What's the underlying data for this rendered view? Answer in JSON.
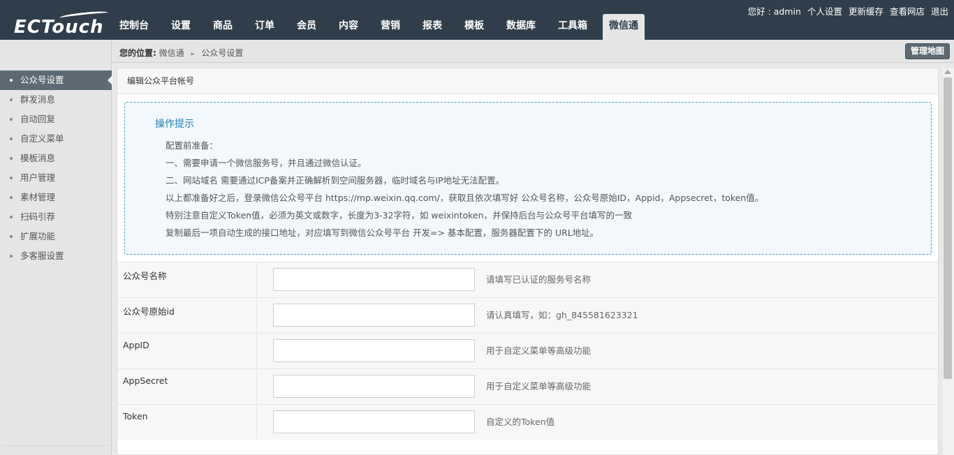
{
  "header": {
    "logo": "ECTouch",
    "nav": [
      "控制台",
      "设置",
      "商品",
      "订单",
      "会员",
      "内容",
      "营销",
      "报表",
      "模板",
      "数据库",
      "工具箱",
      "微信通"
    ],
    "active_nav_index": 11,
    "user_links": [
      "您好 : admin",
      "个人设置",
      "更新缓存",
      "查看网店",
      "退出"
    ]
  },
  "breadcrumb": {
    "prefix": "您的位置:",
    "level1": "微信通",
    "level2": "公众号设置",
    "sitemap_button": "管理地图"
  },
  "sidebar": {
    "items": [
      {
        "label": "公众号设置",
        "active": true
      },
      {
        "label": "群发消息",
        "active": false
      },
      {
        "label": "自动回复",
        "active": false
      },
      {
        "label": "自定义菜单",
        "active": false
      },
      {
        "label": "模板消息",
        "active": false
      },
      {
        "label": "用户管理",
        "active": false
      },
      {
        "label": "素材管理",
        "active": false
      },
      {
        "label": "扫码引荐",
        "active": false
      },
      {
        "label": "扩展功能",
        "active": false
      },
      {
        "label": "多客服设置",
        "active": false
      }
    ]
  },
  "panel": {
    "title": "编辑公众平台帐号",
    "tips_title": "操作提示",
    "tips": [
      "配置前准备：",
      "一、需要申请一个微信服务号，并且通过微信认证。",
      "二、网站域名 需要通过ICP备案并正确解析到空间服务器，临时域名与IP地址无法配置。",
      "以上都准备好之后，登录微信公众号平台 https://mp.weixin.qq.com/，获取且依次填写好 公众号名称，公众号原始ID，Appid，Appsecret，token值。",
      "特别注意自定义Token值，必须为英文或数字，长度为3-32字符，如 weixintoken，并保持后台与公众号平台填写的一致",
      "复制最后一项自动生成的接口地址，对应填写到微信公众号平台 开发=> 基本配置，服务器配置下的 URL地址。"
    ]
  },
  "form": {
    "fields": [
      {
        "label": "公众号名称",
        "value": "",
        "hint": "请填写已认证的服务号名称"
      },
      {
        "label": "公众号原始id",
        "value": "",
        "hint": "请认真填写，如：gh_845581623321"
      },
      {
        "label": "AppID",
        "value": "",
        "hint": "用于自定义菜单等高级功能"
      },
      {
        "label": "AppSecret",
        "value": "",
        "hint": "用于自定义菜单等高级功能"
      },
      {
        "label": "Token",
        "value": "",
        "hint": "自定义的Token值"
      }
    ]
  },
  "colors": {
    "topbar": "#2f3e4a",
    "sidebar_active": "#5d6a73",
    "tips_border": "#49a3c1",
    "tips_title": "#1c7fb6"
  }
}
